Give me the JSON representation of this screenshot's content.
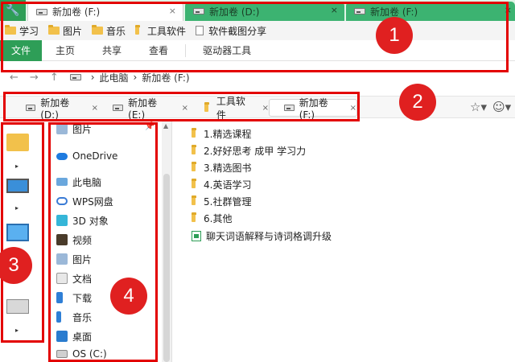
{
  "top_tabs": [
    {
      "label": "新加卷 (F:)",
      "close": "×"
    },
    {
      "label": "新加卷 (D:)",
      "close": "×"
    },
    {
      "label": "新加卷 (F:)",
      "close": "×"
    }
  ],
  "bookmarks": [
    {
      "label": "学习",
      "icon": "folder-icon"
    },
    {
      "label": "图片",
      "icon": "folder-icon"
    },
    {
      "label": "音乐",
      "icon": "folder-icon"
    },
    {
      "label": "工具软件",
      "icon": "folder-icon"
    },
    {
      "label": "软件截图分享",
      "icon": "document-icon"
    }
  ],
  "ribbon_tabs": [
    "文件",
    "主页",
    "共享",
    "查看",
    "驱动器工具"
  ],
  "address": {
    "back": "←",
    "forward": "→",
    "up": "↑",
    "crumbs": [
      "此电脑",
      "新加卷 (F:)"
    ],
    "sep": "›"
  },
  "tabs2": [
    {
      "label": "新加卷 (D:)",
      "close": "×"
    },
    {
      "label": "新加卷 (E:)",
      "close": "×"
    },
    {
      "label": "工具软件",
      "close": "×"
    },
    {
      "label": "新加卷 (F:)",
      "close": "×"
    }
  ],
  "toolbar_right": {
    "star": "☆▾",
    "face": "☺▾"
  },
  "nav_pane": [
    {
      "label": "图片",
      "icon": "pictures-icon",
      "pin": "📌"
    },
    {
      "label": "OneDrive",
      "icon": "onedrive-icon"
    },
    {
      "label": "此电脑",
      "icon": "this-pc-icon"
    },
    {
      "label": "WPS网盘",
      "icon": "wps-cloud-icon"
    },
    {
      "label": "3D 对象",
      "icon": "3d-objects-icon"
    },
    {
      "label": "视频",
      "icon": "videos-icon"
    },
    {
      "label": "图片",
      "icon": "pictures-icon"
    },
    {
      "label": "文档",
      "icon": "documents-icon"
    },
    {
      "label": "下载",
      "icon": "downloads-icon"
    },
    {
      "label": "音乐",
      "icon": "music-icon"
    },
    {
      "label": "桌面",
      "icon": "desktop-icon"
    },
    {
      "label": "OS (C:)",
      "icon": "os-drive-icon"
    }
  ],
  "files": [
    {
      "name": "1.精选课程",
      "type": "folder"
    },
    {
      "name": "2.好好思考 成甲 学习力",
      "type": "folder"
    },
    {
      "name": "3.精选图书",
      "type": "folder"
    },
    {
      "name": "4.英语学习",
      "type": "folder"
    },
    {
      "name": "5.社群管理",
      "type": "folder"
    },
    {
      "name": "6.其他",
      "type": "folder"
    },
    {
      "name": "聊天词语解释与诗词格调升级",
      "type": "spreadsheet"
    }
  ],
  "rail": {
    "arrows": [
      "▸",
      "▸",
      "▸"
    ]
  },
  "annotations": [
    "1",
    "2",
    "3",
    "4"
  ],
  "colors": {
    "accent": "#2e9e57",
    "tab_inactive": "#3cb371",
    "annotation": "#e30000",
    "folder": "#f2c14b"
  }
}
